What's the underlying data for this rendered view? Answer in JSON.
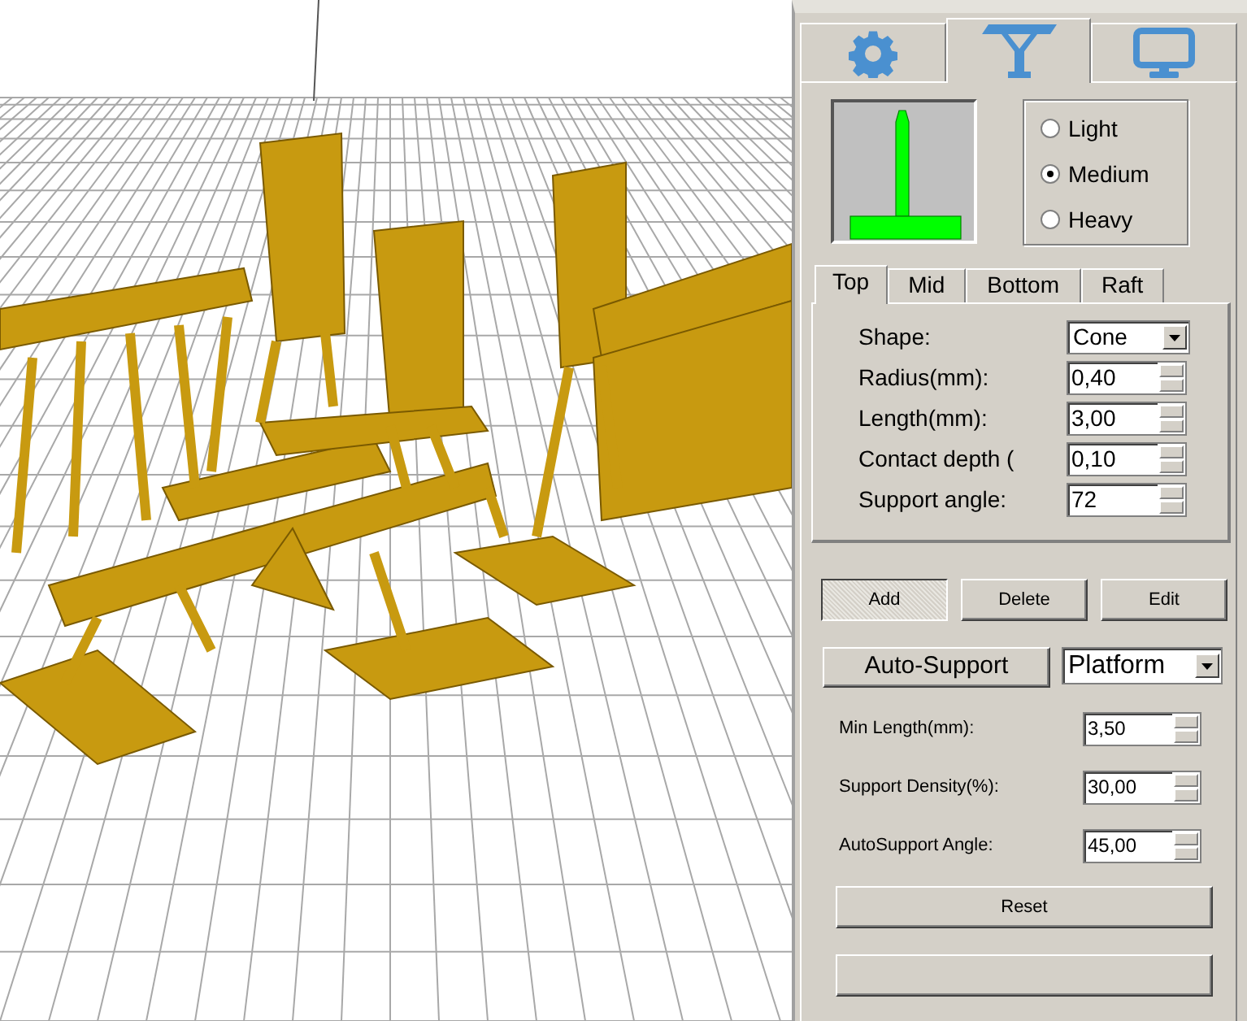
{
  "main_tabs": [
    {
      "kind": "gear",
      "selected": false
    },
    {
      "kind": "support",
      "selected": true
    },
    {
      "kind": "monitor",
      "selected": false
    }
  ],
  "density_options": [
    {
      "label": "Light",
      "selected": false
    },
    {
      "label": "Medium",
      "selected": true
    },
    {
      "label": "Heavy",
      "selected": false
    }
  ],
  "sub_tabs": [
    {
      "label": "Top",
      "selected": true
    },
    {
      "label": "Mid",
      "selected": false
    },
    {
      "label": "Bottom",
      "selected": false
    },
    {
      "label": "Raft",
      "selected": false
    }
  ],
  "fields": [
    {
      "kind": "select",
      "label": "Shape:",
      "value": "Cone"
    },
    {
      "kind": "spin",
      "label": "Radius(mm):",
      "value": "0,40"
    },
    {
      "kind": "spin",
      "label": "Length(mm):",
      "value": "3,00"
    },
    {
      "kind": "spin",
      "label": "Contact depth (",
      "value": "0,10"
    },
    {
      "kind": "spin",
      "label": "Support angle:",
      "value": "72"
    }
  ],
  "actions": [
    {
      "label": "Add",
      "pressed": true
    },
    {
      "label": "Delete",
      "pressed": false
    },
    {
      "label": "Edit",
      "pressed": false
    }
  ],
  "auto_support": {
    "button": "Auto-Support",
    "mode": "Platform"
  },
  "auto_fields": [
    {
      "label": "Min Length(mm):",
      "value": "3,50"
    },
    {
      "label": "Support Density(%):",
      "value": "30,00"
    },
    {
      "label": "AutoSupport Angle:",
      "value": "45,00"
    }
  ],
  "reset_button": "Reset"
}
